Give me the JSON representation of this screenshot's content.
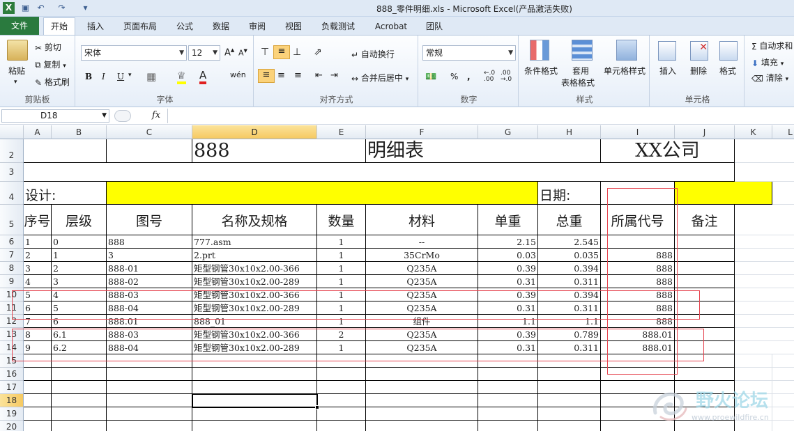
{
  "window": {
    "title": "888_零件明细.xls  -  Microsoft Excel(产品激活失败)"
  },
  "tabs": {
    "file": "文件",
    "items": [
      "开始",
      "插入",
      "页面布局",
      "公式",
      "数据",
      "审阅",
      "视图",
      "负载测试",
      "Acrobat",
      "团队"
    ]
  },
  "ribbon": {
    "clipboard": {
      "label": "剪贴板",
      "paste": "粘贴",
      "cut": "剪切",
      "copy": "复制",
      "format_painter": "格式刷"
    },
    "font": {
      "label": "字体",
      "font_name": "宋体",
      "font_size": "12",
      "bold": "B",
      "italic": "I",
      "underline": "U"
    },
    "alignment": {
      "label": "对齐方式",
      "wrap": "自动换行",
      "merge": "合并后居中"
    },
    "number": {
      "label": "数字",
      "format": "常规"
    },
    "styles": {
      "label": "样式",
      "conditional": "条件格式",
      "table_line1": "套用",
      "table_line2": "表格格式",
      "cell_styles": "单元格样式"
    },
    "cells": {
      "label": "单元格",
      "insert": "插入",
      "delete": "删除",
      "format": "格式"
    },
    "editing": {
      "autosum": "自动求和",
      "fill": "填充",
      "clear": "清除"
    }
  },
  "formula_bar": {
    "name_box": "D18",
    "fx": "fx",
    "content": ""
  },
  "columns": [
    "A",
    "B",
    "C",
    "D",
    "E",
    "F",
    "G",
    "H",
    "I",
    "J",
    "K",
    "L"
  ],
  "selected_column": "D",
  "rows": [
    "2",
    "3",
    "4",
    "5",
    "6",
    "7",
    "8",
    "9",
    "10",
    "11",
    "12",
    "13",
    "14",
    "15",
    "16",
    "17",
    "18",
    "19",
    "20"
  ],
  "selected_row": "18",
  "sheet": {
    "header": {
      "code": "888",
      "title": "明细表",
      "company": "XX公司"
    },
    "designer_label": "设计:",
    "date_label": "日期:",
    "table_headers": [
      "序号",
      "层级",
      "图号",
      "名称及规格",
      "数量",
      "材料",
      "单重",
      "总重",
      "所属代号",
      "备注"
    ],
    "table_rows": [
      [
        "1",
        "0",
        "888",
        "777.asm",
        "1",
        "--",
        "2.15",
        "2.545",
        "",
        ""
      ],
      [
        "2",
        "1",
        "3",
        "2.prt",
        "1",
        "35CrMo",
        "0.03",
        "0.035",
        "888",
        ""
      ],
      [
        "3",
        "2",
        "888-01",
        "矩型钢管30x10x2.00-366",
        "1",
        "Q235A",
        "0.39",
        "0.394",
        "888",
        ""
      ],
      [
        "4",
        "3",
        "888-02",
        "矩型钢管30x10x2.00-289",
        "1",
        "Q235A",
        "0.31",
        "0.311",
        "888",
        ""
      ],
      [
        "5",
        "4",
        "888-03",
        "矩型钢管30x10x2.00-366",
        "1",
        "Q235A",
        "0.39",
        "0.394",
        "888",
        ""
      ],
      [
        "6",
        "5",
        "888-04",
        "矩型钢管30x10x2.00-289",
        "1",
        "Q235A",
        "0.31",
        "0.311",
        "888",
        ""
      ],
      [
        "7",
        "6",
        "888.01",
        "888_01",
        "1",
        "组件",
        "1.1",
        "1.1",
        "888",
        ""
      ],
      [
        "8",
        "6.1",
        "888-03",
        "矩型钢管30x10x2.00-366",
        "2",
        "Q235A",
        "0.39",
        "0.789",
        "888.01",
        ""
      ],
      [
        "9",
        "6.2",
        "888-04",
        "矩型钢管30x10x2.00-289",
        "1",
        "Q235A",
        "0.31",
        "0.311",
        "888.01",
        ""
      ]
    ]
  },
  "watermark": {
    "text": "野火论坛",
    "url": "www.proewildfire.cn"
  },
  "colors": {
    "yellow_fill": "#ffff00",
    "annotation_red": "#e5424d",
    "file_tab": "#2a7a3e"
  }
}
